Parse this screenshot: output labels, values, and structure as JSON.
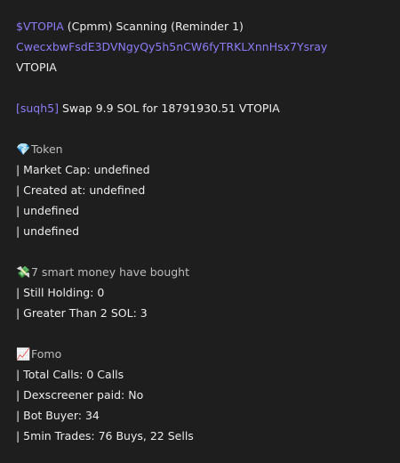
{
  "header": {
    "ticker": "$VTOPIA",
    "suffix": " (Cpmm) Scanning (Reminder 1)",
    "address": "CwecxbwFsdE3DVNgyQy5h5nCW6fyTRKLXnnHsx7Ysray",
    "token_name": "VTOPIA"
  },
  "swap": {
    "user": "[suqh5]",
    "text": " Swap 9.9 SOL for 18791930.51 VTOPIA"
  },
  "token": {
    "icon": "💎",
    "icon_name": "gem-icon",
    "title": "Token",
    "lines": [
      "| Market Cap: undefined",
      "| Created at: undefined",
      "| undefined",
      "| undefined"
    ]
  },
  "smart_money": {
    "icon": "💸",
    "icon_name": "money-with-wings-icon",
    "title": "7 smart money have bought",
    "lines": [
      "| Still Holding: 0",
      "| Greater Than 2 SOL: 3"
    ]
  },
  "fomo": {
    "icon": "📈",
    "icon_name": "chart-increasing-icon",
    "title": "Fomo",
    "lines": [
      "| Total Calls: 0 Calls",
      "| Dexscreener paid: No",
      "| Bot Buyer: 34",
      "| 5min Trades: 76 Buys, 22 Sells"
    ]
  },
  "colors": {
    "background": "#1e1e1e",
    "text": "#ececec",
    "link": "#8b7cf6"
  }
}
